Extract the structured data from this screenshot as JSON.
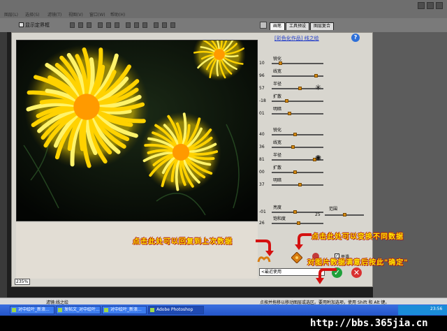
{
  "menu": [
    "图层(L)",
    "选择(S)",
    "滤镜(T)",
    "视图(V)",
    "窗口(W)",
    "帮助(H)"
  ],
  "options_bar": {
    "show_bounds_label": "显示定界框"
  },
  "palette_tabs": [
    "画笔",
    "工具预设",
    "图层复合"
  ],
  "dialog": {
    "filter_link": "[彩色化作品] 线之绘",
    "help": "?",
    "zoom": "235%",
    "group1": [
      {
        "label": "锐化",
        "value": "10",
        "level": 0.15
      },
      {
        "label": "线宽",
        "value": "96",
        "level": 0.88
      },
      {
        "label": "半径",
        "value": "57",
        "level": 0.55
      },
      {
        "label": "扩散",
        "value": "-18",
        "level": 0.28
      },
      {
        "label": "明暗",
        "value": "01",
        "level": 0.33
      }
    ],
    "group2": [
      {
        "label": "锐化",
        "value": "40",
        "level": 0.45
      },
      {
        "label": "线宽",
        "value": "36",
        "level": 0.4
      },
      {
        "label": "半径",
        "value": "81",
        "level": 0.85
      },
      {
        "label": "扩散",
        "value": "00",
        "level": 0.45
      },
      {
        "label": "明暗",
        "value": "37",
        "level": 0.55
      }
    ],
    "group3": [
      {
        "label": "亮度",
        "value": "-01",
        "level": 0.45
      },
      {
        "label": "饱和度",
        "value": "26",
        "level": 0.52
      }
    ],
    "range": {
      "label": "范围",
      "value": "25",
      "level": 0.5
    },
    "smooth_label": "平滑",
    "preset": "<最近使用",
    "ok": "✓",
    "cancel": "✕"
  },
  "annotations": {
    "left": "点击此处可以回复到上次数据",
    "right": "点击此处可以变换不同数据",
    "ok": "对图片数据满意后按此\"确定\""
  },
  "status": {
    "filter": "滤镜:线之绘",
    "hint": "点按并拖移以移动图层或选区。要用附加选项，使用 Shift 和 Alt 键。"
  },
  "taskbar": {
    "items": [
      "对中绘叶_新浪...",
      "发帖文_对中绘叶...",
      "对中绘叶_新浪...",
      "Adobe Photoshop"
    ],
    "clock": "23:56"
  },
  "watermark": "http://bbs.365jia.cn",
  "colors": {
    "accent": "#d68a10",
    "ok": "#1fa03a",
    "cancel": "#d93030",
    "annotation": "#ffea00"
  }
}
